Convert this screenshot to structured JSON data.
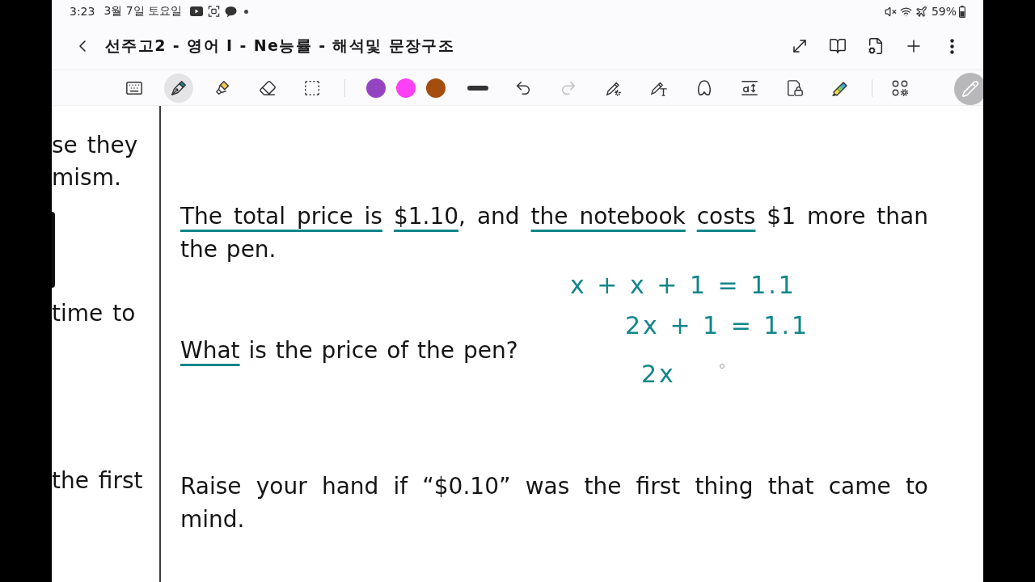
{
  "status_bar": {
    "time": "3:23",
    "date": "3월 7일 토요일",
    "battery": "59%"
  },
  "title_bar": {
    "title": "선주고2 - 영어 Ⅰ - Ne능률 - 해석및 문장구조"
  },
  "toolbar": {
    "tools": [
      {
        "kind": "keyboard",
        "selected": false
      },
      {
        "kind": "pen",
        "selected": true
      },
      {
        "kind": "highlighter",
        "selected": false
      },
      {
        "kind": "eraser",
        "selected": false
      },
      {
        "kind": "selection",
        "selected": false
      }
    ],
    "colors": [
      {
        "color": "#9444c0"
      },
      {
        "color": "#ff40f5"
      },
      {
        "color": "#a34e0c"
      }
    ],
    "actions": [
      {
        "kind": "stroke",
        "disabled": false
      },
      {
        "kind": "undo",
        "disabled": false
      },
      {
        "kind": "redo",
        "disabled": true
      },
      {
        "kind": "shape-pen",
        "disabled": false
      },
      {
        "kind": "text-pen",
        "disabled": false
      },
      {
        "kind": "shape",
        "disabled": false
      },
      {
        "kind": "text-size",
        "disabled": false
      },
      {
        "kind": "lock",
        "disabled": false
      },
      {
        "kind": "rainbow-pen",
        "disabled": false
      }
    ]
  },
  "left_column": {
    "lines": [
      "se they",
      "mism.",
      "time to",
      "the first"
    ]
  },
  "paragraphs": [
    {
      "segments": [
        {
          "text": "The total price is ",
          "underlined": true
        },
        {
          "text": "$1.10",
          "underlined": true
        },
        {
          "text": ", and ",
          "underlined": false
        },
        {
          "text": "the notebook ",
          "underlined": true
        },
        {
          "text": "costs",
          "underlined": true
        },
        {
          "text": " $1 more than the pen.",
          "underlined": false
        }
      ]
    },
    {
      "segments": [
        {
          "text": "What",
          "underlined": true
        },
        {
          "text": " is the price of the pen?",
          "underlined": false
        }
      ]
    },
    {
      "segments": [
        {
          "text": "Raise your hand if “$0.10” was the first thing that came to mind.",
          "underlined": false
        }
      ]
    }
  ],
  "handwriting": {
    "lines": [
      "x + x + 1 = 1.1",
      "2x + 1 = 1.1",
      "2x"
    ]
  }
}
